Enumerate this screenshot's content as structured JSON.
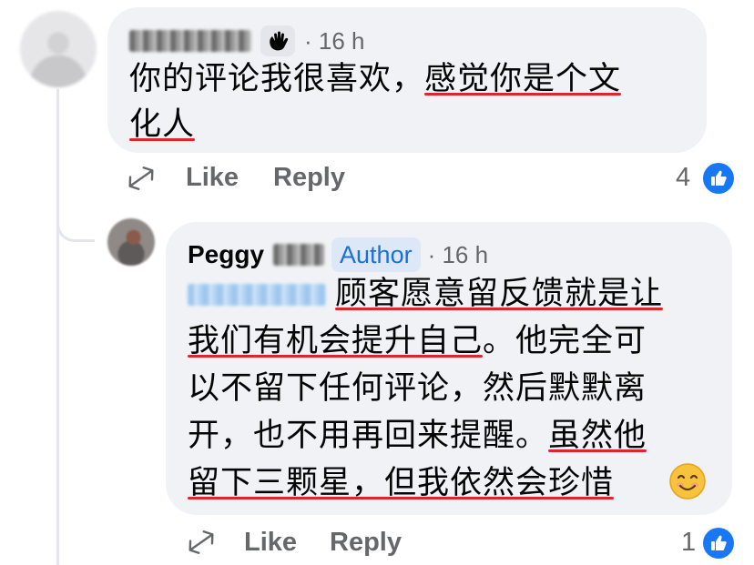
{
  "comment_1": {
    "author_name": "",
    "timestamp": "· 16 h",
    "text_plain": "你的评论我很喜欢，",
    "text_underlined_1": "感觉你是个文",
    "text_underlined_2": "化人",
    "actions": {
      "like_label": "Like",
      "reply_label": "Reply"
    },
    "like_count": "4"
  },
  "reply_1": {
    "author_name": "Peggy",
    "author_badge": "Author",
    "timestamp": "· 16 h",
    "lines": [
      {
        "u": "顾客愿意留反馈就是让"
      },
      {
        "u": "我们有机会提升自己",
        "t": "。他完全可"
      },
      {
        "t": "以不留下任何评论，然后默默离"
      },
      {
        "t": "开，也不用再回来提醒。",
        "u": "虽然他"
      },
      {
        "u": "留下三颗星，但我依然会珍惜",
        "emoji": "😊"
      }
    ],
    "actions": {
      "like_label": "Like",
      "reply_label": "Reply"
    },
    "like_count": "1"
  },
  "icons": {
    "share": "share-icon",
    "wave_badge": "wave-hand-icon",
    "like_badge": "thumbs-up-icon",
    "emoji": "smiling-face-icon"
  },
  "colors": {
    "bubble": "#f0f2f5",
    "underline": "#e0242c",
    "author_badge": "#1b6fd8",
    "like_blue": "#1877f2",
    "secondary_text": "#65676b"
  }
}
